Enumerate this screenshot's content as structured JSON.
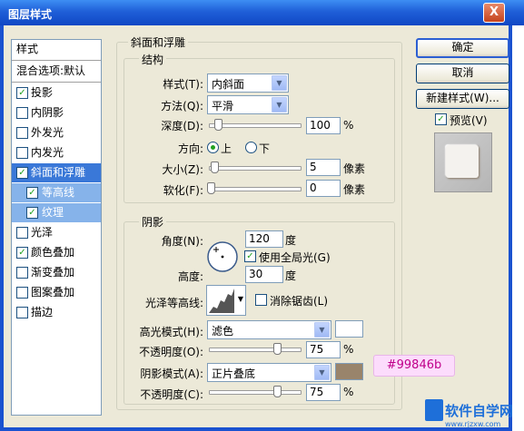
{
  "window": {
    "title": "图层样式",
    "close": "X"
  },
  "sidebar": {
    "header": "样式",
    "blend_options": "混合选项:默认",
    "items": [
      {
        "label": "投影",
        "checked": true
      },
      {
        "label": "内阴影",
        "checked": false
      },
      {
        "label": "外发光",
        "checked": false
      },
      {
        "label": "内发光",
        "checked": false
      },
      {
        "label": "斜面和浮雕",
        "checked": true
      },
      {
        "label": "等高线",
        "checked": true
      },
      {
        "label": "纹理",
        "checked": true
      },
      {
        "label": "光泽",
        "checked": false
      },
      {
        "label": "颜色叠加",
        "checked": true
      },
      {
        "label": "渐变叠加",
        "checked": false
      },
      {
        "label": "图案叠加",
        "checked": false
      },
      {
        "label": "描边",
        "checked": false
      }
    ]
  },
  "bevel": {
    "title": "斜面和浮雕",
    "structure": {
      "title": "结构",
      "style_label": "样式(T):",
      "style_value": "内斜面",
      "technique_label": "方法(Q):",
      "technique_value": "平滑",
      "depth_label": "深度(D):",
      "depth_value": "100",
      "depth_unit": "%",
      "depth_level": 0.1,
      "direction_label": "方向:",
      "direction_up": "上",
      "direction_down": "下",
      "direction_selected": "上",
      "size_label": "大小(Z):",
      "size_value": "5",
      "size_unit": "像素",
      "soften_label": "软化(F):",
      "soften_value": "0",
      "soften_unit": "像素"
    },
    "shading": {
      "title": "阴影",
      "angle_label": "角度(N):",
      "angle_value": "120",
      "angle_unit": "度",
      "global_light_label": "使用全局光(G)",
      "global_light_checked": true,
      "altitude_label": "高度:",
      "altitude_value": "30",
      "altitude_unit": "度",
      "gloss_label": "光泽等高线:",
      "antialias_label": "消除锯齿(L)",
      "antialias_checked": false,
      "highlight_mode_label": "高光模式(H):",
      "highlight_mode_value": "滤色",
      "highlight_color": "#ffffff",
      "highlight_opacity_label": "不透明度(O):",
      "highlight_opacity_value": "75",
      "highlight_opacity_unit": "%",
      "highlight_opacity_level": 0.75,
      "shadow_mode_label": "阴影模式(A):",
      "shadow_mode_value": "正片叠底",
      "shadow_color": "#99846b",
      "shadow_opacity_label": "不透明度(C):",
      "shadow_opacity_value": "75",
      "shadow_opacity_unit": "%",
      "shadow_opacity_level": 0.75
    }
  },
  "buttons": {
    "ok": "确定",
    "cancel": "取消",
    "new_style": "新建样式(W)...",
    "preview": "预览(V)",
    "preview_checked": true
  },
  "annotation": "#99846b",
  "watermark": {
    "brand": "软件自学网",
    "url": "www.rjzxw.com"
  },
  "colors": {
    "accent": "#3a78d8",
    "titlebar": "#1f5fd8",
    "shadow_swatch": "#99846b"
  }
}
